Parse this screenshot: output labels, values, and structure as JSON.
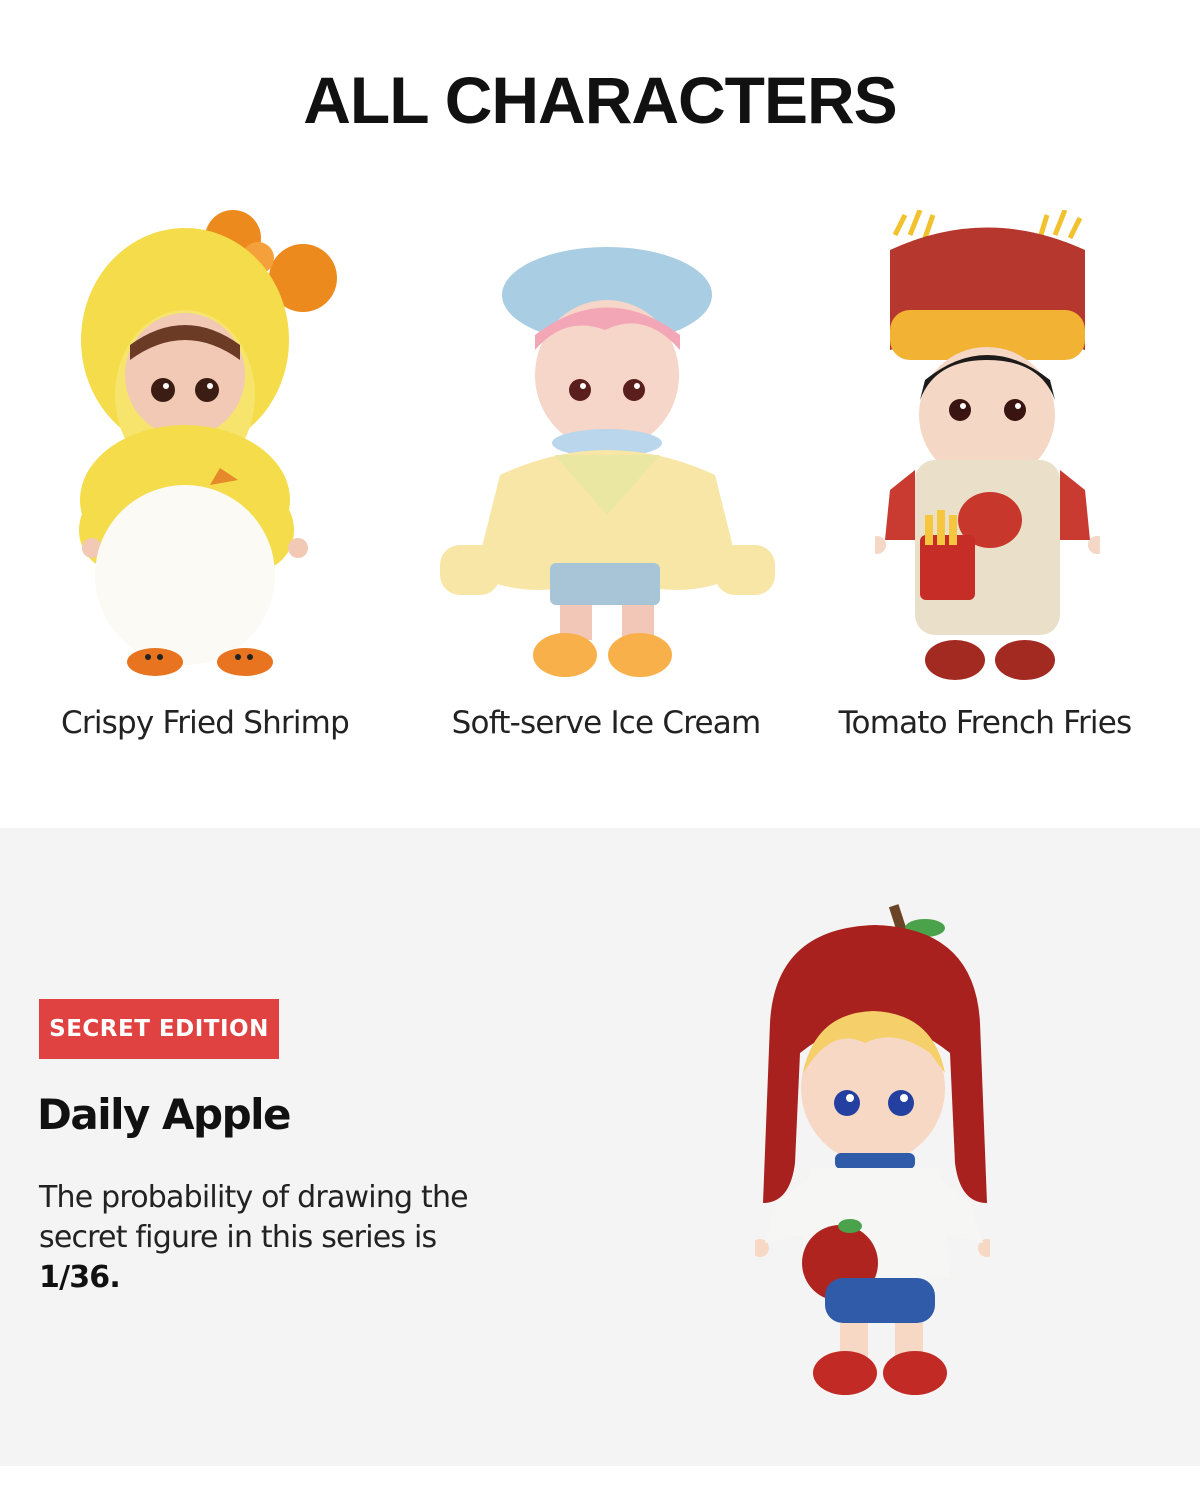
{
  "heading": "ALL CHARACTERS",
  "characters": [
    {
      "name": "Crispy Fried Shrimp",
      "icon": "doll-yellow-fluffy-hood"
    },
    {
      "name": "Soft-serve Ice Cream",
      "icon": "doll-pink-hair-blue-beret"
    },
    {
      "name": "Tomato French Fries",
      "icon": "doll-red-knit-hat-overalls"
    }
  ],
  "secret": {
    "badge": "SECRET EDITION",
    "name": "Daily Apple",
    "description": "The probability of drawing the secret figure in this series is",
    "probability": "1/36.",
    "icon": "doll-red-apple-hat",
    "badge_color": "#e04141"
  }
}
